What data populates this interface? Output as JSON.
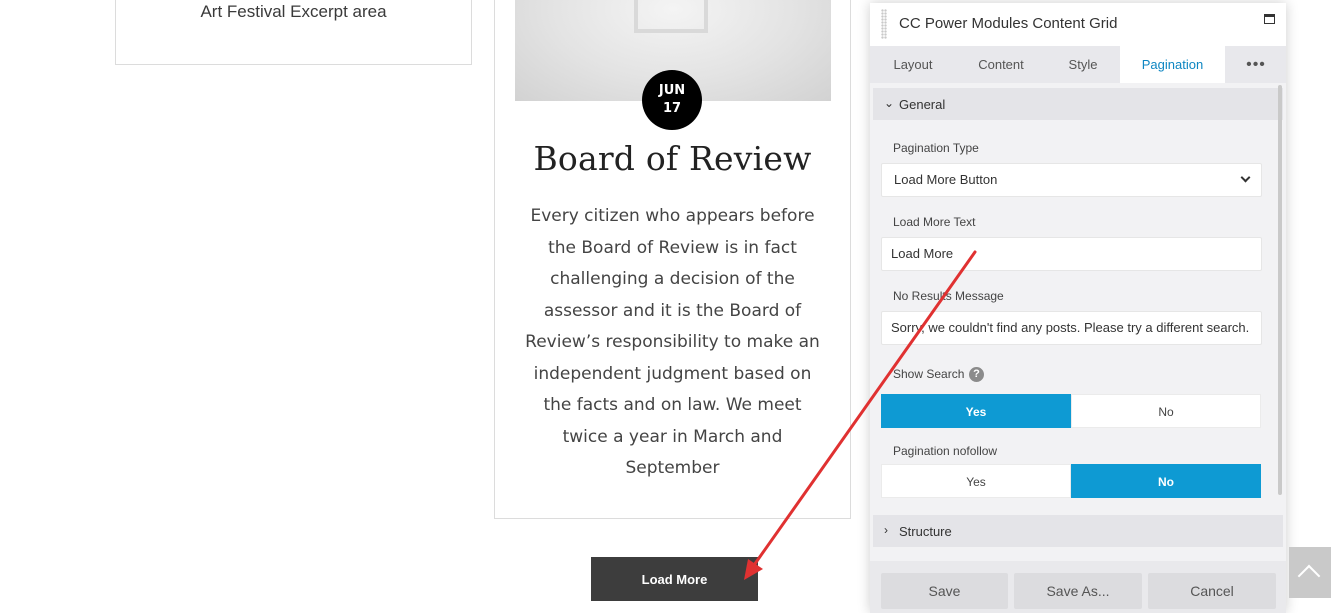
{
  "left_card": {
    "excerpt": "Art Festival Excerpt area"
  },
  "post": {
    "date_month": "JUN",
    "date_day": "17",
    "title": "Board of Review",
    "body": "Every citizen who appears before the Board of Review is in fact challenging a decision of the assessor and it is the Board of Review’s responsibility to make an independent judgment based on the facts and on law.  We meet twice a year in March and September"
  },
  "load_more_button": "Load More",
  "panel": {
    "title": "CC Power Modules Content Grid",
    "tabs": [
      {
        "label": "Layout",
        "active": false
      },
      {
        "label": "Content",
        "active": false
      },
      {
        "label": "Style",
        "active": false
      },
      {
        "label": "Pagination",
        "active": true
      }
    ],
    "more_tabs": "•••",
    "general_section": "General",
    "pagination_type_label": "Pagination Type",
    "pagination_type_value": "Load More Button",
    "load_more_text_label": "Load More Text",
    "load_more_text_value": "Load More",
    "no_results_label": "No Results Message",
    "no_results_value": "Sorry, we couldn't find any posts. Please try a different search.",
    "show_search_label": "Show Search",
    "help": "?",
    "show_search_yes": "Yes",
    "show_search_no": "No",
    "show_search_value": "Yes",
    "nofollow_label": "Pagination nofollow",
    "nofollow_yes": "Yes",
    "nofollow_no": "No",
    "nofollow_value": "No",
    "structure_section": "Structure",
    "footer": {
      "save": "Save",
      "save_as": "Save As...",
      "cancel": "Cancel"
    }
  },
  "colors": {
    "accent": "#0e9ad3",
    "tab_active_text": "#0e86c2",
    "annotation_arrow": "#e03131"
  }
}
